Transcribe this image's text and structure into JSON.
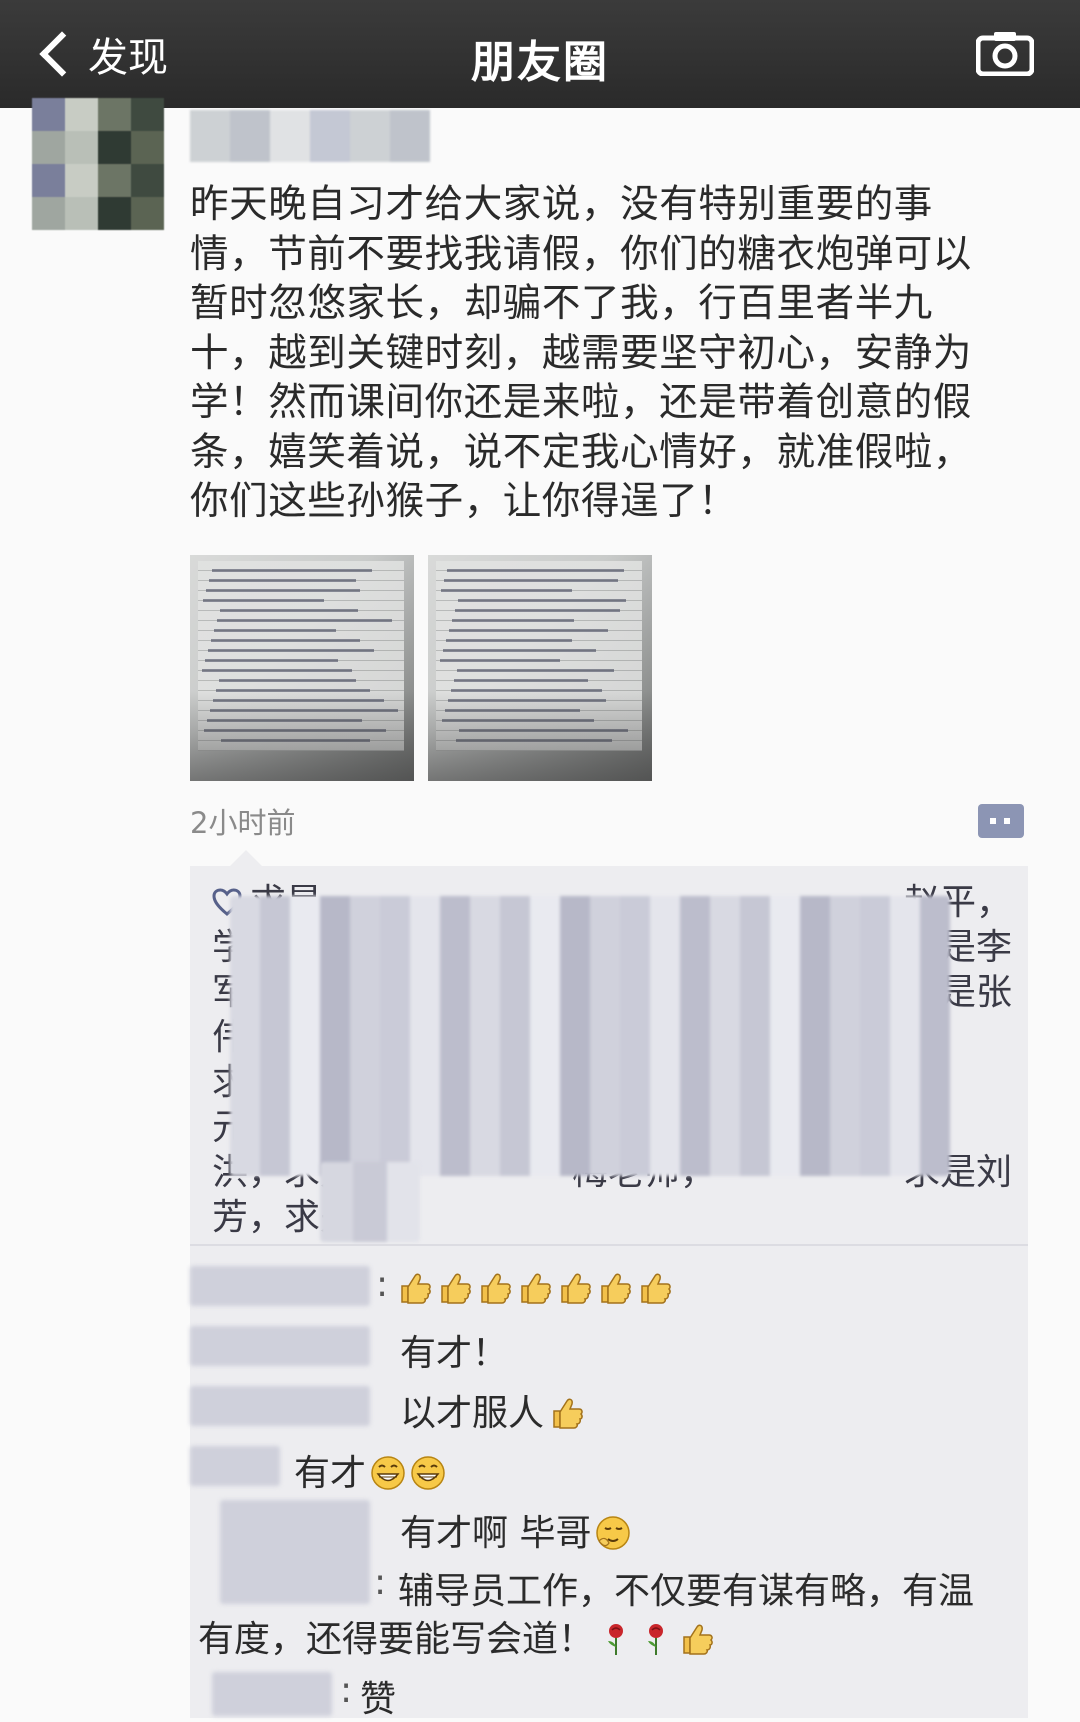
{
  "nav": {
    "back_label": "发现",
    "title": "朋友圈"
  },
  "post": {
    "text_lines": [
      "昨天晚自习才给大家说，没有特别重要的事",
      "情，节前不要找我请假，你们的糖衣炮弹可以",
      "暂时忽悠家长，却骗不了我，行百里者半九",
      "十，越到关键时刻，越需要坚守初心，安静为",
      "学！然而课间你还是来啦，还是带着创意的假",
      "条，嬉笑着说，说不定我心情好，就准假啦，",
      "你们这些孙猴子，让你得逞了！"
    ],
    "photo_count": 2,
    "time": "2小时前"
  },
  "likes": {
    "visible_fragments": [
      {
        "left": "求是",
        "right": "赵平，"
      },
      {
        "left": "学生",
        "right": "是李"
      },
      {
        "left": "军，",
        "right": "是张"
      },
      {
        "left": "伟",
        "right": ""
      },
      {
        "left": "求",
        "right": ""
      },
      {
        "left": "元",
        "right": ""
      },
      {
        "left": "洪，求是",
        "right": "梅老师，",
        "right2": "求是刘"
      },
      {
        "left": "芳，求是",
        "right": ""
      }
    ]
  },
  "comments": [
    {
      "text": "",
      "emojis": [
        "thumbs-up",
        "thumbs-up",
        "thumbs-up",
        "thumbs-up",
        "thumbs-up",
        "thumbs-up",
        "thumbs-up"
      ]
    },
    {
      "text": "有才！",
      "emojis": []
    },
    {
      "text": "以才服人",
      "emojis": [
        "thumbs-up"
      ]
    },
    {
      "text": "有才",
      "emojis": [
        "grin-face",
        "grin-face"
      ]
    },
    {
      "text": "有才啊 毕哥",
      "emojis": [
        "shy-face"
      ]
    },
    {
      "text_line1": "辅导员工作，不仅要有谋有略，有温",
      "text_line2": "有度，还得要能写会道！",
      "emojis": [
        "rose",
        "rose",
        "thumbs-up"
      ]
    },
    {
      "text": "赞",
      "emojis": []
    }
  ],
  "colors": {
    "navbar": "#2f2f2f",
    "background": "#fafafa",
    "comment_box": "#ededf0",
    "blur_mosaic": "#c7c8d6"
  }
}
